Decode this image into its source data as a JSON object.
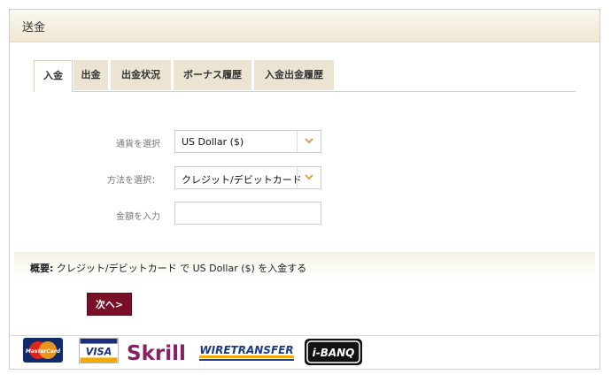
{
  "panel": {
    "title": "送金"
  },
  "tabs": [
    {
      "label": "入金",
      "active": true
    },
    {
      "label": "出金",
      "active": false
    },
    {
      "label": "出金状況",
      "active": false
    },
    {
      "label": "ボーナス履歴",
      "active": false
    },
    {
      "label": "入金出金履歴",
      "active": false
    }
  ],
  "form": {
    "currency": {
      "label": "通貨を選択",
      "value": "US Dollar ($)"
    },
    "method": {
      "label": "方法を選択：",
      "value": "クレジット/デビットカード"
    },
    "amount": {
      "label": "金額を入力",
      "value": ""
    }
  },
  "summary": {
    "label": "概要:",
    "text": "クレジット/デビットカード で US Dollar ($) を入金する"
  },
  "next_button": "次へ>",
  "payment_logos": {
    "mastercard": "MasterCard",
    "visa": "VISA",
    "skrill": "Skrill",
    "wiretransfer": "WIRETRANSFER",
    "ibanq": "i-BANQ"
  },
  "colors": {
    "accent_dark": "#7a1028",
    "header_tint": "#efe6d2",
    "dropdown_arrow": "#e0a24a"
  },
  "icons": {
    "dropdown": "chevron-down-icon"
  }
}
